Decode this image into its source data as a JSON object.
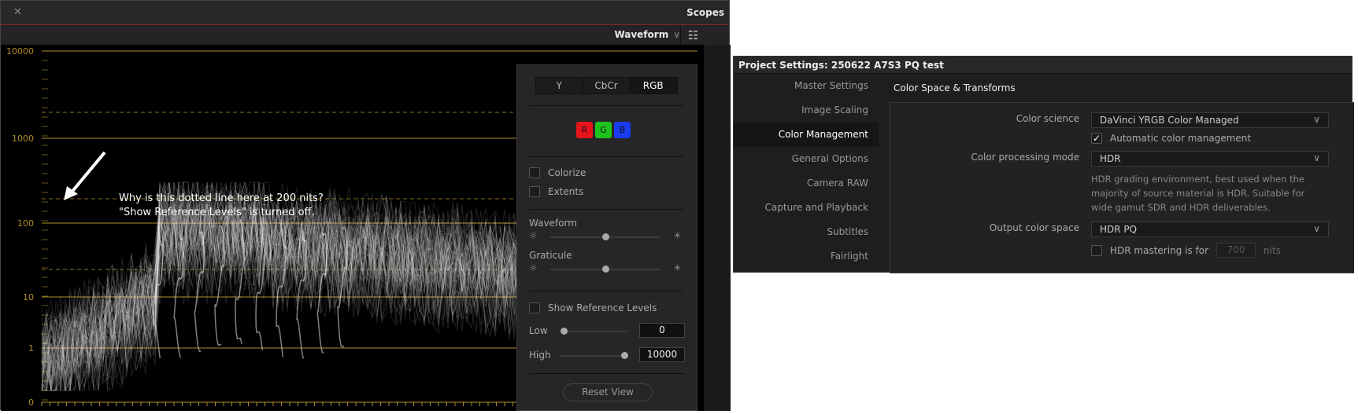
{
  "scopes": {
    "title": "Scopes",
    "close_icon": "close-icon",
    "mode": "Waveform",
    "settings_icon": "sliders-icon",
    "y_axis_labels": [
      "10000",
      "1000",
      "100",
      "10",
      "1",
      "0"
    ],
    "graticule_color": "#b08b2a",
    "annotation": [
      "Why is this dotted line here at 200 nits?",
      "\"Show Reference Levels\" is turned off."
    ],
    "panel": {
      "tabs": [
        {
          "label": "Y",
          "active": false
        },
        {
          "label": "CbCr",
          "active": false
        },
        {
          "label": "RGB",
          "active": true
        }
      ],
      "channels": [
        {
          "label": "R",
          "color": "#e8141c"
        },
        {
          "label": "G",
          "color": "#1ec41e"
        },
        {
          "label": "B",
          "color": "#1a3cf0"
        }
      ],
      "colorize": {
        "label": "Colorize",
        "checked": false
      },
      "extents": {
        "label": "Extents",
        "checked": false
      },
      "waveform_label": "Waveform",
      "waveform_level": 0.5,
      "graticule_label": "Graticule",
      "graticule_level": 0.5,
      "show_ref": {
        "label": "Show Reference Levels",
        "checked": false
      },
      "low_label": "Low",
      "low_value": "0",
      "high_label": "High",
      "high_value": "10000",
      "reset_label": "Reset View"
    }
  },
  "project": {
    "title": "Project Settings:  250622 A7S3 PQ test",
    "sidebar": [
      "Master Settings",
      "Image Scaling",
      "Color Management",
      "General Options",
      "Camera RAW",
      "Capture and Playback",
      "Subtitles",
      "Fairlight"
    ],
    "selected": "Color Management",
    "section_title": "Color Space & Transforms",
    "color_science_label": "Color science",
    "color_science": "DaVinci YRGB Color Managed",
    "auto_cm_label": "Automatic color management",
    "auto_cm_checked": true,
    "processing_label": "Color processing mode",
    "processing": "HDR",
    "description": "HDR grading environment, best used when the majority of source material is HDR. Suitable for wide gamut SDR and HDR deliverables.",
    "output_label": "Output color space",
    "output": "HDR PQ",
    "mastering_label": "HDR mastering is for",
    "mastering_value": "700",
    "mastering_unit": "nits",
    "mastering_checked": false
  }
}
